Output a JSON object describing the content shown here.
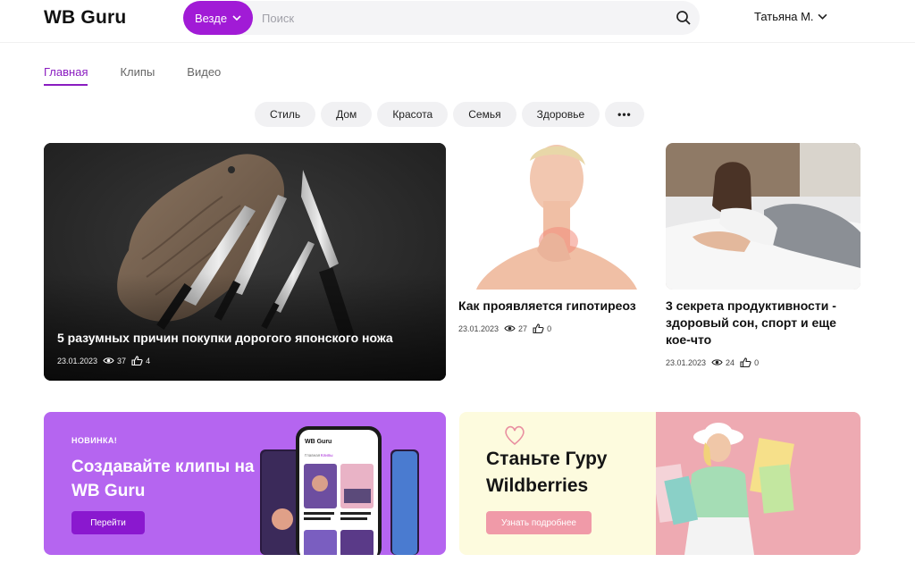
{
  "header": {
    "logo": "WB Guru",
    "scope_label": "Везде",
    "search_placeholder": "Поиск",
    "user_name": "Татьяна М."
  },
  "tabs": [
    {
      "label": "Главная",
      "active": true
    },
    {
      "label": "Клипы",
      "active": false
    },
    {
      "label": "Видео",
      "active": false
    }
  ],
  "categories": [
    "Стиль",
    "Дом",
    "Красота",
    "Семья",
    "Здоровье"
  ],
  "more_label": "•••",
  "articles": {
    "hero": {
      "title": "5 разумных причин покупки дорогого японского ножа",
      "date": "23.01.2023",
      "views": "37",
      "likes": "4"
    },
    "card1": {
      "title": "Как проявляется гипотиреоз",
      "date": "23.01.2023",
      "views": "27",
      "likes": "0"
    },
    "card2": {
      "title": "3 секрета продуктивности - здоровый сон, спорт и еще кое-что",
      "date": "23.01.2023",
      "views": "24",
      "likes": "0"
    }
  },
  "banners": {
    "clips": {
      "badge": "НОВИНКА!",
      "title": "Создавайте клипы на WB Guru",
      "button": "Перейти",
      "phone_logo": "WB Guru",
      "phone_tab1": "Главная",
      "phone_tab2": "Клипы"
    },
    "guru": {
      "title": "Станьте Гуру Wildberries",
      "button": "Узнать подробнее"
    }
  },
  "colors": {
    "accent": "#a11bd6",
    "clips_banner": "#b565f0",
    "guru_banner": "#fdfbde",
    "guru_button": "#f09aa8"
  },
  "icons": {
    "search": "search-icon",
    "chevron": "chevron-down-icon",
    "views": "eye-icon",
    "likes": "thumbs-up-icon"
  }
}
